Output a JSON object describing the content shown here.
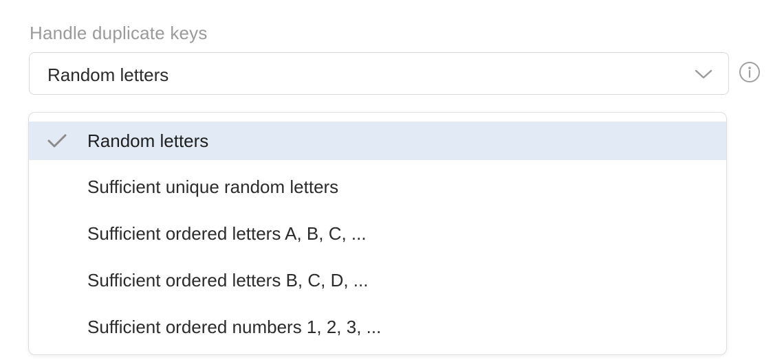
{
  "field": {
    "label": "Handle duplicate keys",
    "selected_value": "Random letters",
    "chevron_icon": "chevron-down-icon",
    "info_icon": "info-icon"
  },
  "dropdown": {
    "options": [
      {
        "label": "Random letters",
        "selected": true
      },
      {
        "label": "Sufficient unique random letters",
        "selected": false
      },
      {
        "label": "Sufficient ordered letters A, B, C, ...",
        "selected": false
      },
      {
        "label": "Sufficient ordered letters B, C, D, ...",
        "selected": false
      },
      {
        "label": "Sufficient ordered numbers 1, 2, 3, ...",
        "selected": false
      }
    ],
    "check_icon": "check-icon"
  },
  "colors": {
    "selected_background": "#e1eaf5",
    "label_gray": "#9a9a9a",
    "text": "#2b2b2b",
    "border": "#d9d9d9"
  }
}
